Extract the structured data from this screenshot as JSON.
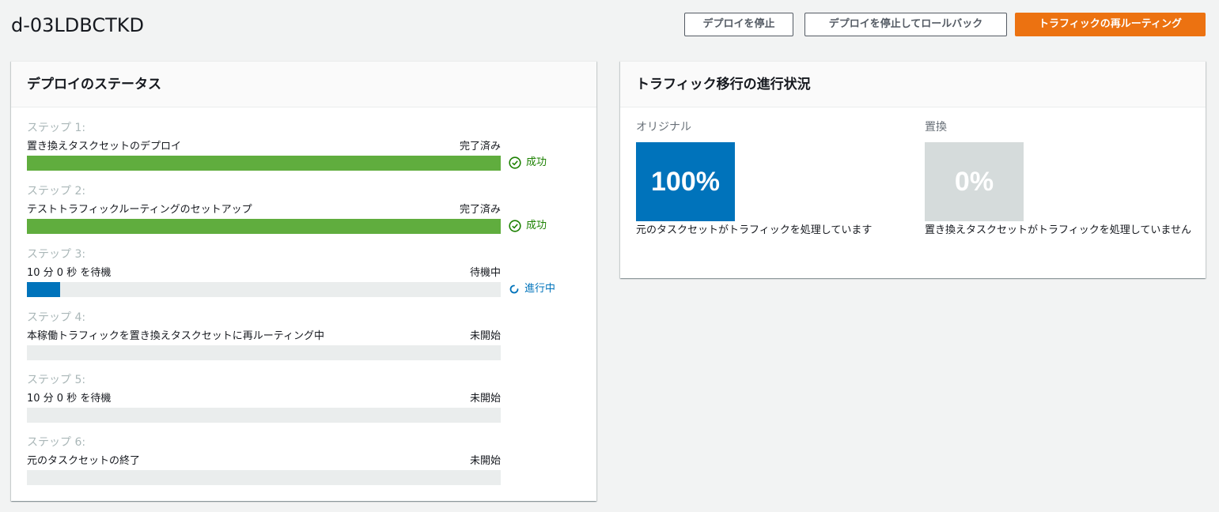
{
  "header": {
    "title": "d-03LDBCTKD",
    "buttons": {
      "stop": "デプロイを停止",
      "stop_rollback": "デプロイを停止してロールバック",
      "reroute": "トラフィックの再ルーティング"
    }
  },
  "status_panel": {
    "title": "デプロイのステータス",
    "steps": [
      {
        "num": "ステップ 1:",
        "label": "置き換えタスクセットのデプロイ",
        "state": "完了済み",
        "progress": 1.0,
        "result": "成功"
      },
      {
        "num": "ステップ 2:",
        "label": "テストトラフィックルーティングのセットアップ",
        "state": "完了済み",
        "progress": 1.0,
        "result": "成功"
      },
      {
        "num": "ステップ 3:",
        "label": "10 分 0 秒 を待機",
        "state": "待機中",
        "progress": 0.07,
        "result": "進行中"
      },
      {
        "num": "ステップ 4:",
        "label": "本稼働トラフィックを置き換えタスクセットに再ルーティング中",
        "state": "未開始",
        "progress": 0
      },
      {
        "num": "ステップ 5:",
        "label": "10 分 0 秒 を待機",
        "state": "未開始",
        "progress": 0
      },
      {
        "num": "ステップ 6:",
        "label": "元のタスクセットの終了",
        "state": "未開始",
        "progress": 0
      }
    ]
  },
  "traffic_panel": {
    "title": "トラフィック移行の進行状況",
    "original": {
      "label": "オリジナル",
      "percent": "100%",
      "desc": "元のタスクセットがトラフィックを処理しています"
    },
    "replacement": {
      "label": "置換",
      "percent": "0%",
      "desc": "置き換えタスクセットがトラフィックを処理していません"
    }
  },
  "colors": {
    "success_bar": "#60ad3e",
    "progress_bar": "#0073bb",
    "primary": "#ec7211",
    "original_box": "#0073bb",
    "replacement_box": "#d5dbdb"
  }
}
